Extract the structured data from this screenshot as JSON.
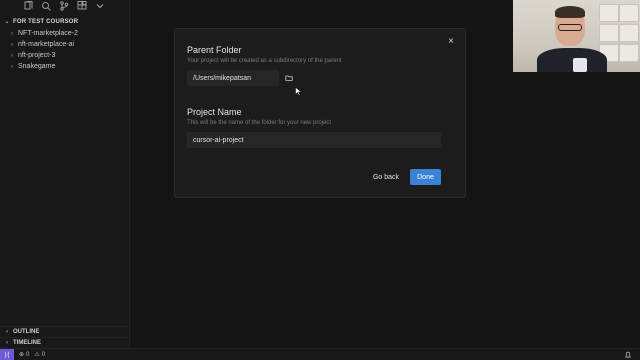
{
  "sidebar": {
    "section_title": "FOR TEST COURSOR",
    "items": [
      {
        "label": "NFT-marketplace-2"
      },
      {
        "label": "nft-marketplace-ai"
      },
      {
        "label": "nft-project-3"
      },
      {
        "label": "Snakegame"
      }
    ],
    "outline_label": "OUTLINE",
    "timeline_label": "TIMELINE"
  },
  "statusbar": {
    "errors": "0",
    "warnings": "0"
  },
  "dialog": {
    "parent_folder_label": "Parent Folder",
    "parent_folder_hint": "Your project will be created as a subdirectory of the parent",
    "parent_folder_value": "/Users/mikepatsan",
    "project_name_label": "Project Name",
    "project_name_hint": "This will be the name of the folder for your new project",
    "project_name_value": "cursor-ai-project",
    "go_back_label": "Go back",
    "done_label": "Done"
  },
  "colors": {
    "accent": "#3b82d6",
    "remote": "#6b5bd6"
  }
}
